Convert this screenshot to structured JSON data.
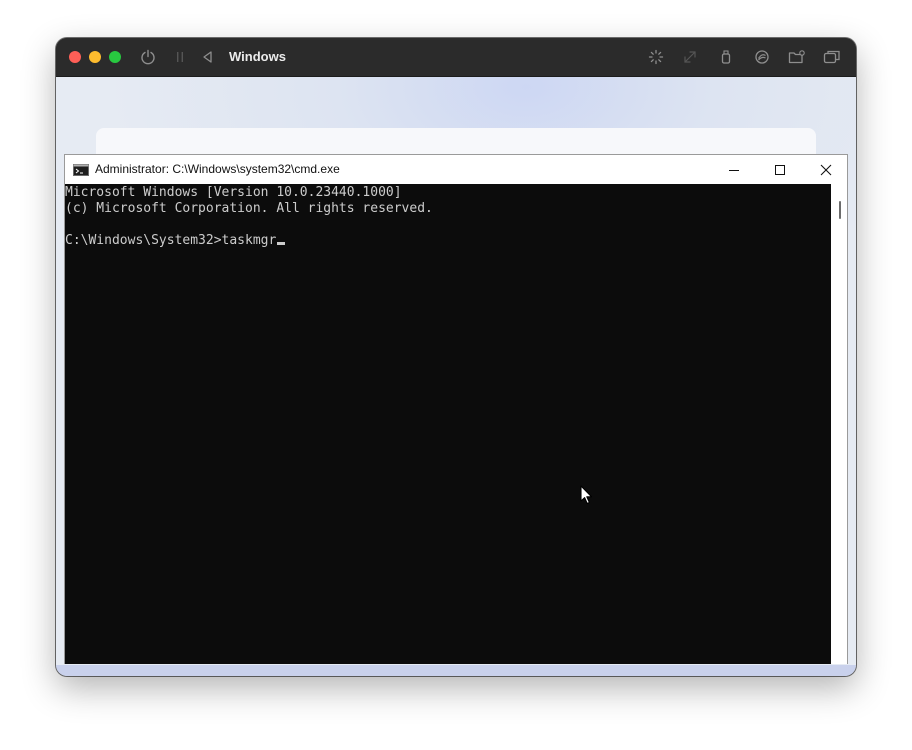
{
  "vm_window": {
    "title": "Windows",
    "toolbar": {
      "power_icon": "power-icon",
      "pause_icon": "pause-icon",
      "back_icon": "back-icon",
      "brightness_icon": "brightness-icon",
      "resize_icon": "resize-icon",
      "usb_icon": "usb-icon",
      "network_icon": "network-icon",
      "shared_folder_icon": "shared-folder-icon",
      "windows_icon": "windows-icon"
    }
  },
  "cmd_window": {
    "title": "Administrator: C:\\Windows\\system32\\cmd.exe",
    "app_icon": "cmd-icon",
    "controls": {
      "minimize_icon": "minimize-icon",
      "maximize_icon": "maximize-icon",
      "close_icon": "close-icon"
    },
    "console": {
      "lines": [
        "Microsoft Windows [Version 10.0.23440.1000]",
        "(c) Microsoft Corporation. All rights reserved.",
        "C:\\Windows\\System32>taskmgr"
      ]
    }
  },
  "colors": {
    "console_background": "#0c0c0c",
    "console_text": "#cccccc",
    "mac_titlebar": "#2b2b2b"
  }
}
